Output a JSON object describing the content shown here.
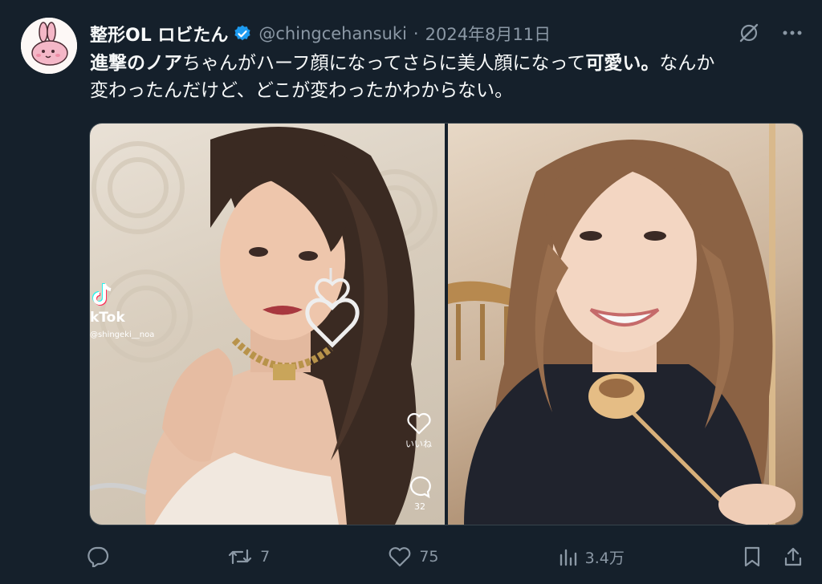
{
  "author": {
    "display_name": "整形OL ロビたん",
    "handle": "@chingcehansuki",
    "separator": "·",
    "date": "2024年8月11日"
  },
  "tweet": {
    "part1_bold": "進撃のノア",
    "part2": "ちゃんがハーフ顔になってさらに美人顔になって",
    "part3_bold": "可愛い。",
    "part4": "なんか",
    "line2": "変わったんだけど、どこが変わったかわからない。"
  },
  "media": {
    "left_overlay": {
      "app_label": "kTok",
      "username": "@shingeki__noa",
      "like_label": "いいね",
      "comment_count": "32"
    }
  },
  "actions": {
    "retweet_count": "7",
    "like_count": "75",
    "view_count": "3.4万"
  },
  "colors": {
    "background": "#15202b",
    "text": "#f7f9f9",
    "muted": "#8b98a5",
    "verified": "#1d9bf0"
  }
}
